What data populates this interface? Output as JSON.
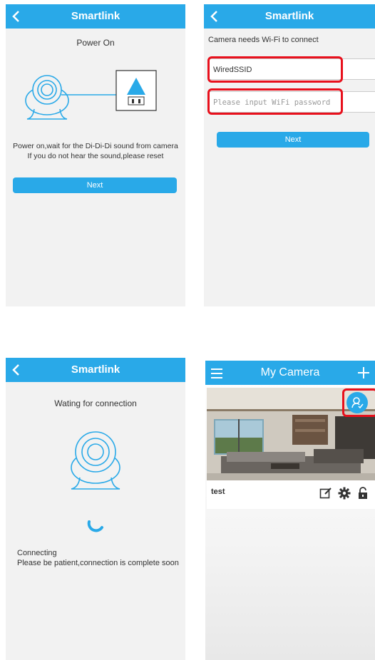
{
  "screen1": {
    "title": "Smartlink",
    "heading": "Power On",
    "instruction_line1": "Power on,wait for the Di-Di-Di sound from camera",
    "instruction_line2": "If you do not hear the sound,please reset",
    "next_label": "Next"
  },
  "screen2": {
    "title": "Smartlink",
    "prompt": "Camera needs Wi-Fi to connect",
    "ssid_value": "WiredSSID",
    "password_placeholder": "Please input WiFi password",
    "next_label": "Next"
  },
  "screen3": {
    "title": "Smartlink",
    "heading": "Wating for connection",
    "status_line1": "Connecting",
    "status_line2": "Please be patient,connection is complete soon"
  },
  "screen4": {
    "title": "My Camera",
    "camera_name": "test",
    "icons": [
      "menu-icon",
      "add-icon",
      "share-user-icon",
      "edit-icon",
      "gear-icon",
      "unlock-icon"
    ]
  },
  "colors": {
    "accent": "#29a9e8",
    "highlight": "#e8101c"
  }
}
